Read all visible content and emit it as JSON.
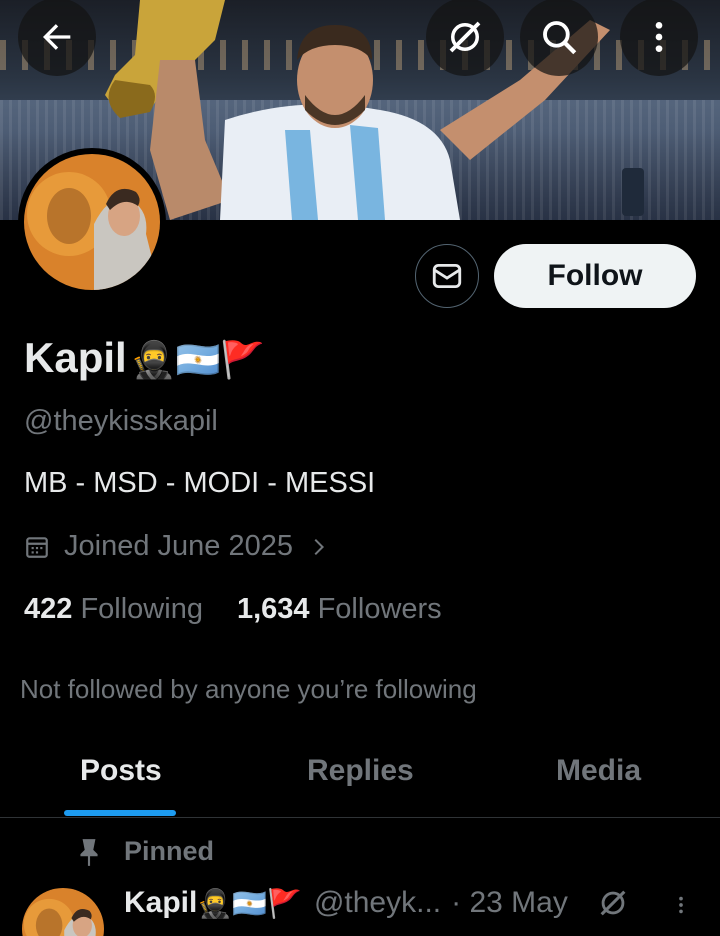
{
  "header": {
    "back_icon": "arrow-left-icon",
    "grok_icon": "grok-icon",
    "search_icon": "search-icon",
    "more_icon": "more-vertical-icon"
  },
  "profile": {
    "name": "Kapil",
    "name_emojis": "🥷🇦🇷🚩",
    "handle": "@theykisskapil",
    "bio": "MB - MSD - MODI - MESSI",
    "joined": "Joined June 2025",
    "following_count": "422",
    "following_label": "Following",
    "followers_count": "1,634",
    "followers_label": "Followers",
    "not_followed": "Not followed by anyone you’re following"
  },
  "actions": {
    "follow_label": "Follow",
    "message_icon": "envelope-icon"
  },
  "tabs": [
    {
      "label": "Posts",
      "active": true
    },
    {
      "label": "Replies",
      "active": false
    },
    {
      "label": "Media",
      "active": false
    }
  ],
  "pinned_post": {
    "pinned_label": "Pinned",
    "author": "Kapil",
    "author_emojis": "🥷🇦🇷🚩",
    "handle": "@theyk...",
    "date": "· 23 May"
  },
  "colors": {
    "accent": "#1d9bf0",
    "background": "#000000",
    "muted": "#71767b",
    "follow_button": "#eff3f4"
  }
}
